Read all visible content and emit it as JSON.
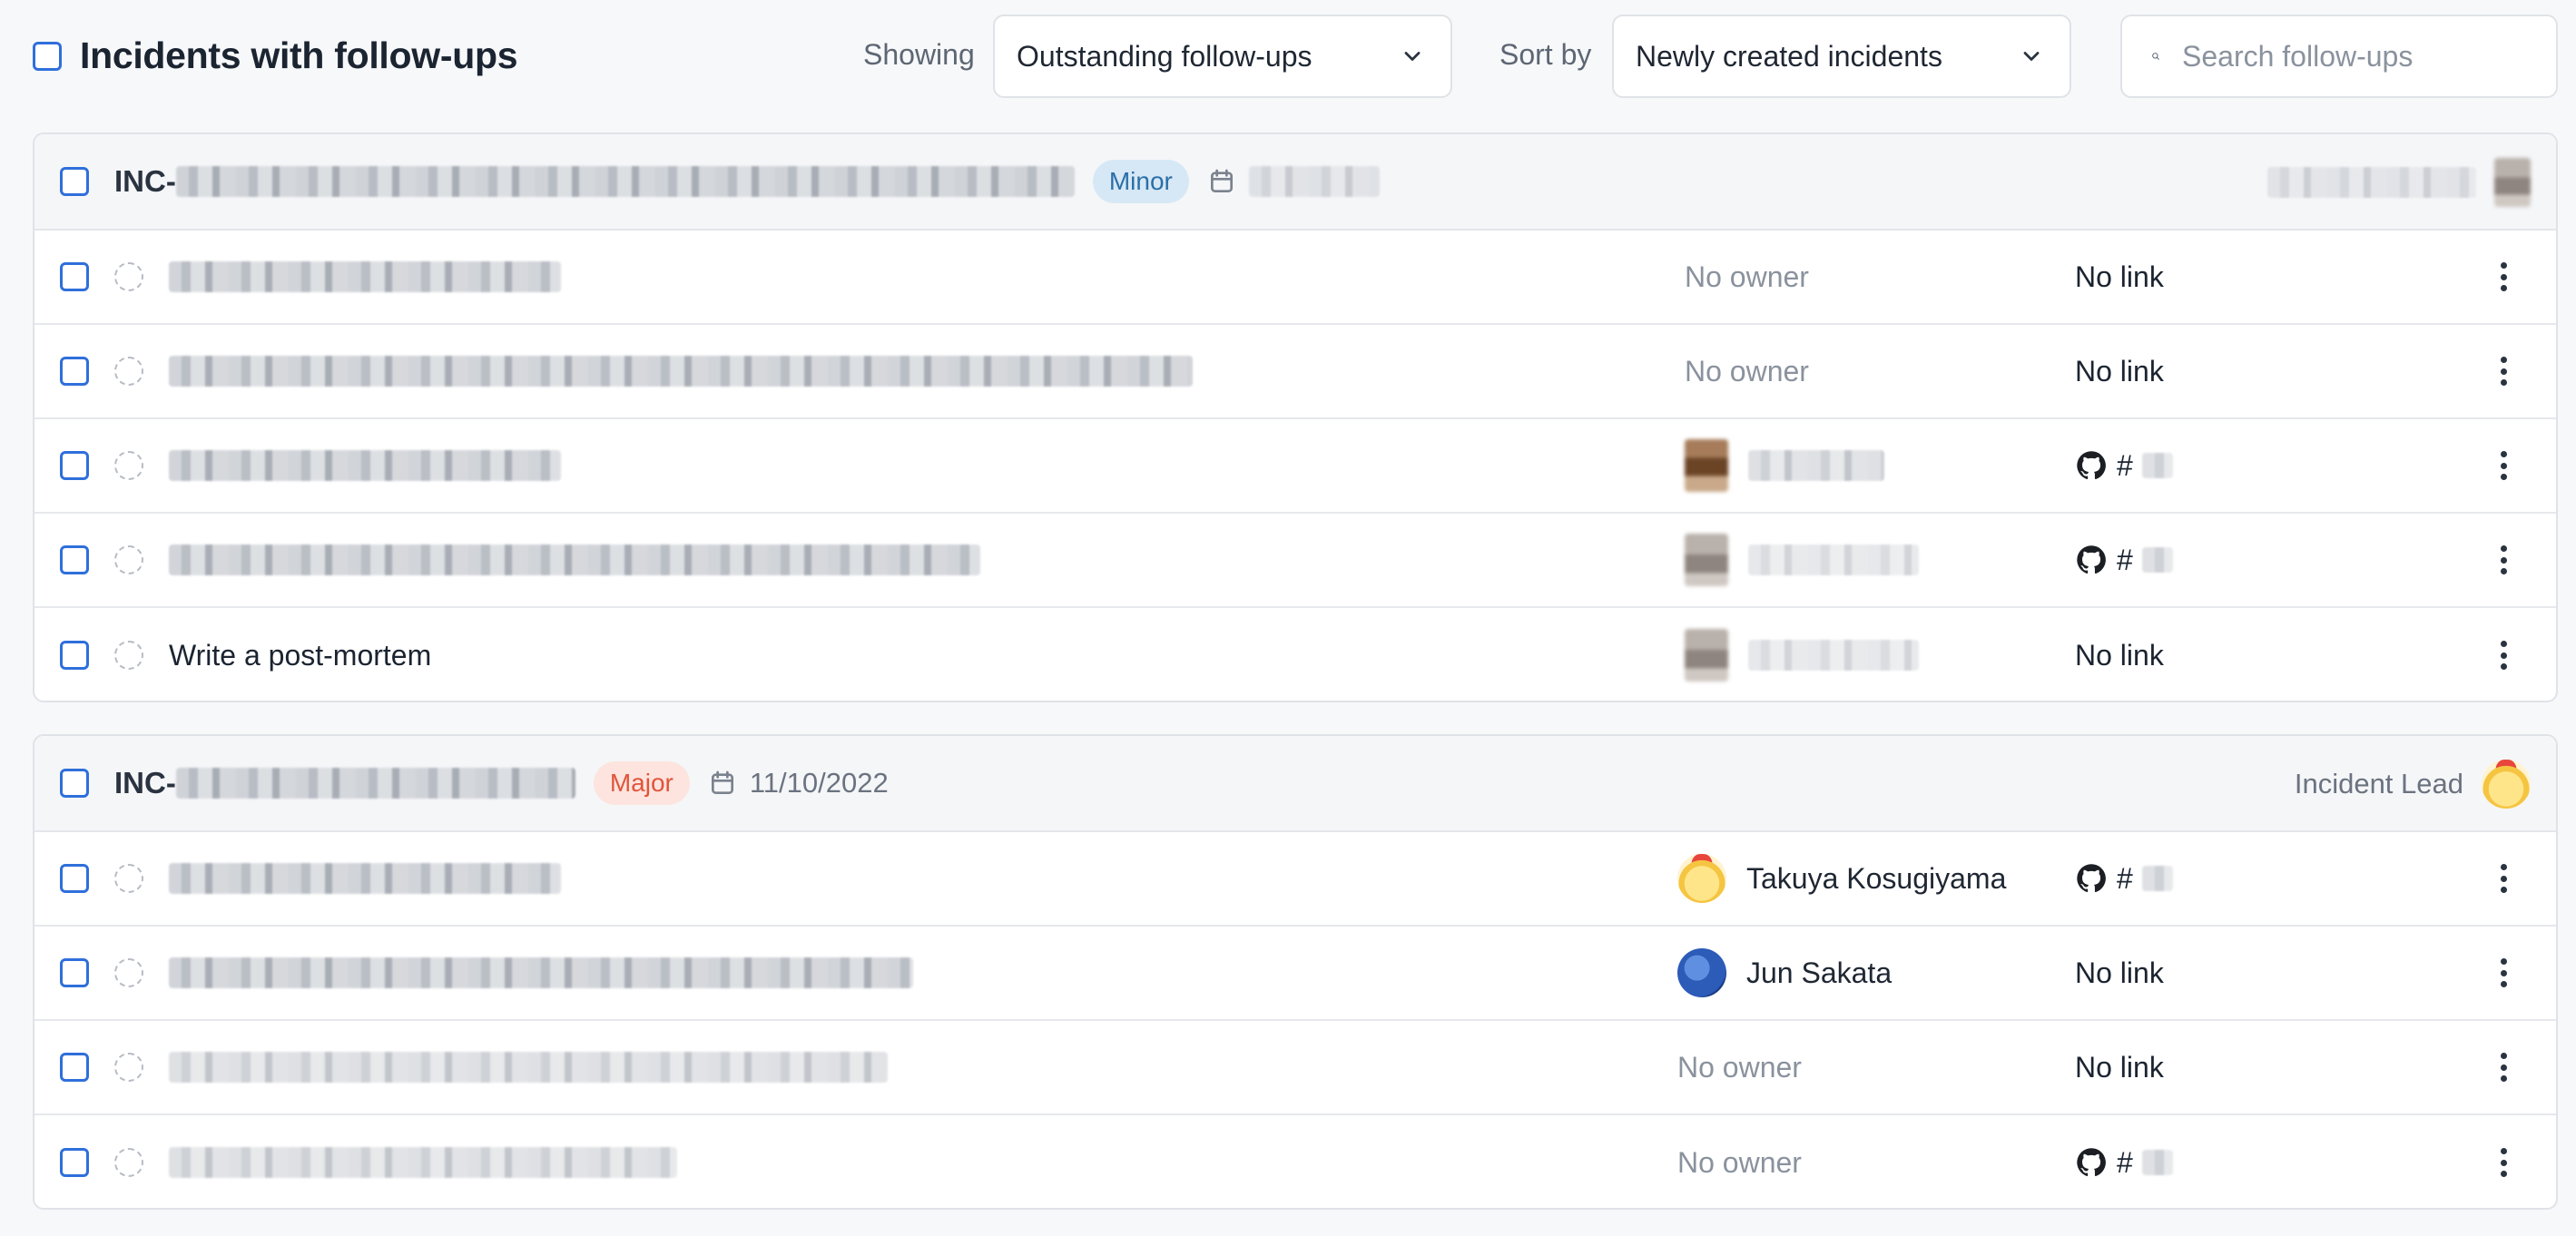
{
  "header": {
    "title": "Incidents with follow-ups",
    "showing_label": "Showing",
    "showing_value": "Outstanding follow-ups",
    "sort_label": "Sort by",
    "sort_value": "Newly created incidents",
    "search_placeholder": "Search follow-ups"
  },
  "incidents": [
    {
      "id_prefix": "INC-",
      "severity": "Minor",
      "date": "",
      "lead_label": "",
      "followups": [
        {
          "title": "",
          "owner": "No owner",
          "link": "No link"
        },
        {
          "title": "",
          "owner": "No owner",
          "link": "No link"
        },
        {
          "title": "",
          "owner": "",
          "link": "#"
        },
        {
          "title": "",
          "owner": "",
          "link": "#"
        },
        {
          "title": "Write a post-mortem",
          "owner": "",
          "link": "No link"
        }
      ]
    },
    {
      "id_prefix": "INC-",
      "severity": "Major",
      "date": "11/10/2022",
      "lead_label": "Incident Lead",
      "followups": [
        {
          "title": "",
          "owner": "Takuya Kosugiyama",
          "link": "#"
        },
        {
          "title": "",
          "owner": "Jun Sakata",
          "link": "No link"
        },
        {
          "title": "",
          "owner": "No owner",
          "link": "No link"
        },
        {
          "title": "",
          "owner": "No owner",
          "link": "#"
        }
      ]
    }
  ],
  "colors": {
    "accent": "#2f6fdb",
    "minor_bg": "#d6e8f5",
    "minor_fg": "#2b6fa8",
    "major_bg": "#fde4df",
    "major_fg": "#e0553a"
  },
  "icons": [
    "chevron-down-icon",
    "search-icon",
    "calendar-icon",
    "github-icon",
    "kebab-menu-icon"
  ]
}
